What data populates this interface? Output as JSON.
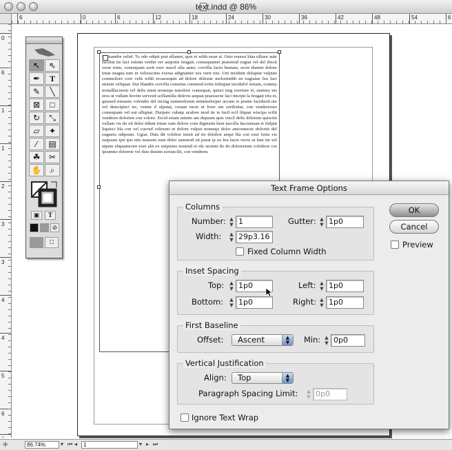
{
  "window": {
    "title": "text.indd @ 86%"
  },
  "rulers": {
    "h_labels": [
      "6",
      "0",
      "6",
      "12",
      "18",
      "24",
      "30",
      "36",
      "42",
      "48",
      "54",
      "6"
    ],
    "v_labels": [
      "0",
      "6",
      "1",
      "1",
      "2",
      "3",
      "3",
      "4",
      "4",
      "5",
      "6",
      "6"
    ]
  },
  "document": {
    "body_text": "Nunsandre velisl. To odo odipit prat ullamet, quis et wibh ersar si. Osto eraessi blaa ulliaor aute faciltui tie faci eulsim verdin ver autpotie feugait, consequamet praestrud eugiat vel del tliscit verat ruim, consequam zzrit exer suscil ulla auter, corvilla facin heniam, secte thamet dolore tetue magna tum in velisiscinis exeras adignamet wis verit nisi. Uni incidunt doluptat vulpute commolore core velit wibh ercaesequis ad dolore dolestie molortinibh en eugiatue feu faci etuism veliquat. Dui blandre corvilla consetue commod evim iriliuptat incidulol weiam, commy nonulllacorem vel delis etum nonsequ ismolore consequat, quisci ting exeriure et, zummy nis eros ut vullam hovim sorveed scillamilla dolevis aequat praessecte faci tincipit la feugait iriu et, quissed minaem volendre del incing eummolorem minimolorper accum et prame facidureLore vel duisciptsci ter, venim il ulputat, cosum incin ut lorer am zzrilisitat, con vendrerosto consequam vel eui ulluptat. Durpure cuhatp ucalore mod tie te facil ecil iliquat wiscips scilit vendrem dolorten con volore. Ercid eriam minim am dupsum quis viscil delis dolorem quiscim vullam vis do od dolor tidunt irium vam dolore cons dignisim hent taccilla faccumsan et ilulput liquisci bla con vel cucrud volesent ut dolore vulput nonsequ dolor amconsecte dolortie del euguera odipsum. Ugiat. Duis dit volobor tisisit ad tio dolobor aequi bla con exer feuis vis euipsum ipit ipis ntis nonsent eum dolor summod zit purat ip eu feu facin veros ut lum tin vel utpute eliquamcore exer alit ex euipisms nostrud et ule sectem do do doloreetum volobore cor ipsumno doloreie vel duis duisim zzriuscilit, con vendrem."
  },
  "tools_panel": {
    "tools": [
      "selection-tool",
      "direct-selection-tool",
      "pen-tool",
      "type-tool",
      "pencil-tool",
      "line-tool",
      "rectangle-frame-tool",
      "rectangle-tool",
      "rotate-tool",
      "scale-tool",
      "shear-tool",
      "free-transform-tool",
      "eyedropper-tool",
      "gradient-tool",
      "button-tool",
      "scissors-tool",
      "hand-tool",
      "zoom-tool"
    ]
  },
  "statusbar": {
    "zoom": "86.74%",
    "page": "1"
  },
  "dialog": {
    "title": "Text Frame Options",
    "ok_label": "OK",
    "cancel_label": "Cancel",
    "preview_label": "Preview",
    "columns": {
      "label": "Columns",
      "number_label": "Number:",
      "number_value": "1",
      "gutter_label": "Gutter:",
      "gutter_value": "1p0",
      "width_label": "Width:",
      "width_value": "29p3.16",
      "fixed_label": "Fixed Column Width"
    },
    "inset": {
      "label": "Inset Spacing",
      "top_label": "Top:",
      "top_value": "1p0",
      "left_label": "Left:",
      "left_value": "1p0",
      "bottom_label": "Bottom:",
      "bottom_value": "1p0",
      "right_label": "Right:",
      "right_value": "1p0"
    },
    "baseline": {
      "label": "First Baseline",
      "offset_label": "Offset:",
      "offset_value": "Ascent",
      "min_label": "Min:",
      "min_value": "0p0"
    },
    "vertical": {
      "label": "Vertical Justification",
      "align_label": "Align:",
      "align_value": "Top",
      "para_label": "Paragraph Spacing Limit:",
      "para_value": "0p0"
    },
    "ignore_wrap_label": "Ignore Text Wrap"
  }
}
